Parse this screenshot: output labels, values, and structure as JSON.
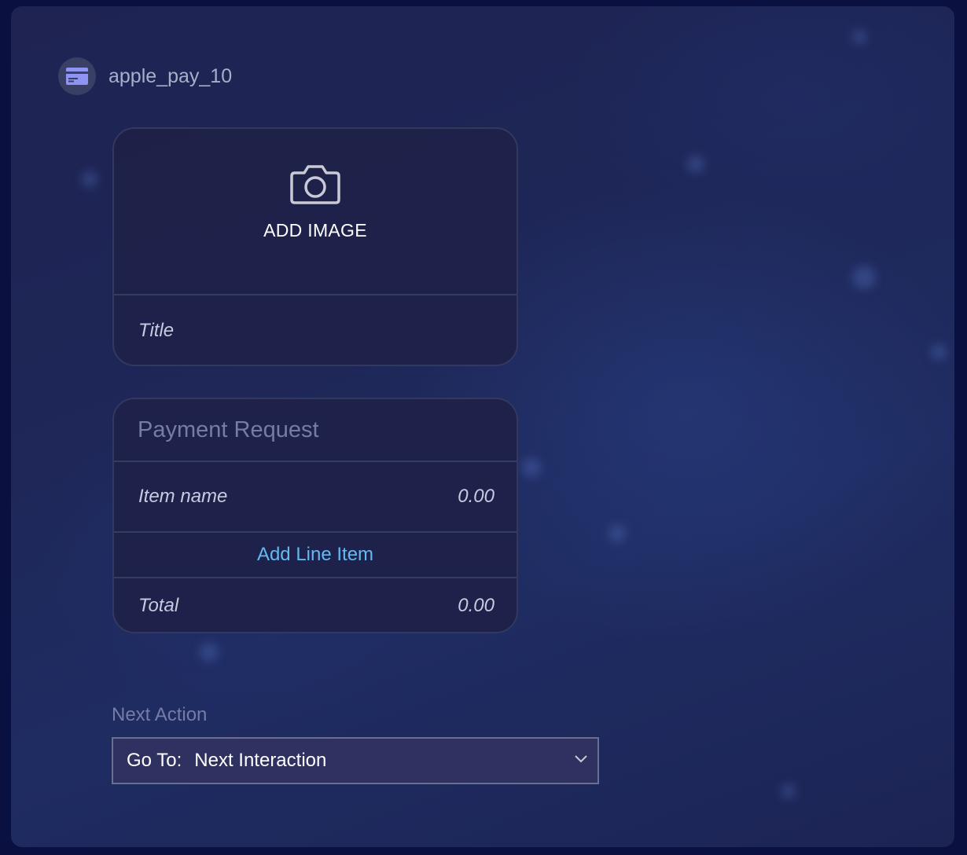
{
  "header": {
    "title": "apple_pay_10",
    "icon": "credit-card-icon"
  },
  "image_card": {
    "add_image_label": "ADD IMAGE",
    "icon": "camera-icon",
    "title_placeholder": "Title"
  },
  "payment_card": {
    "header": "Payment Request",
    "line_item": {
      "name": "Item name",
      "amount": "0.00"
    },
    "add_line_item_label": "Add Line Item",
    "total": {
      "label": "Total",
      "amount": "0.00"
    }
  },
  "next_action": {
    "label": "Next Action",
    "prefix": "Go To:",
    "value": "Next Interaction",
    "icon": "chevron-down-icon"
  },
  "colors": {
    "background": "#1e2758",
    "card": "#1e2148",
    "accent_link": "#64b9f0",
    "card_icon": "#8f93f2"
  }
}
